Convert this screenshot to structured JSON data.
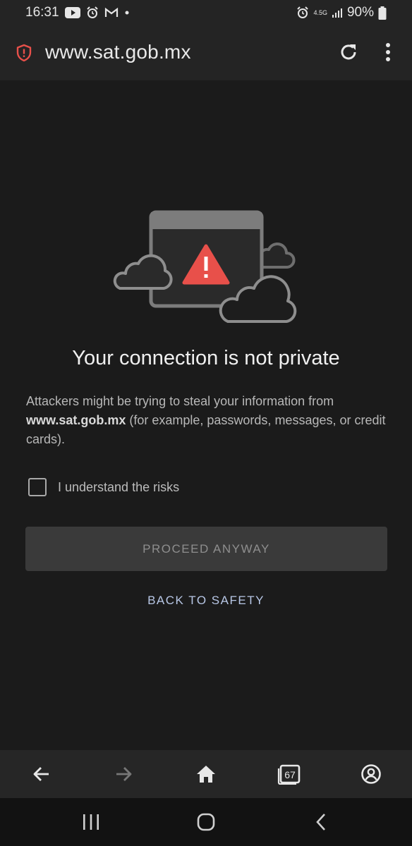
{
  "status_bar": {
    "time": "16:31",
    "battery": "90%",
    "network": "4.5G",
    "icons": [
      "youtube-icon",
      "alarm-clock-icon",
      "gmail-icon",
      "dot-icon",
      "alarm-icon",
      "network-arrows-icon",
      "signal-icon",
      "battery-icon"
    ]
  },
  "url_bar": {
    "url": "www.sat.gob.mx",
    "security_icon": "warning-shield-icon",
    "reload_icon": "reload-icon",
    "menu_icon": "more-vertical-icon",
    "accent_color": "#e8504a"
  },
  "interstitial": {
    "headline": "Your connection is not private",
    "description_prefix": "Attackers might be trying to steal your information from ",
    "description_domain": "www.sat.gob.mx",
    "description_suffix": " (for example, passwords, messages, or credit cards).",
    "risk_checkbox_label": "I understand the risks",
    "risk_checked": false,
    "proceed_label": "PROCEED ANYWAY",
    "back_label": "BACK TO SAFETY",
    "warning_color": "#e8504a"
  },
  "toolbar": {
    "tab_count": "67",
    "icons": [
      "back-arrow-icon",
      "forward-arrow-icon",
      "home-icon",
      "tabs-icon",
      "account-icon"
    ]
  },
  "nav_bar": {
    "icons": [
      "recent-apps-icon",
      "home-button-icon",
      "back-button-icon"
    ]
  }
}
